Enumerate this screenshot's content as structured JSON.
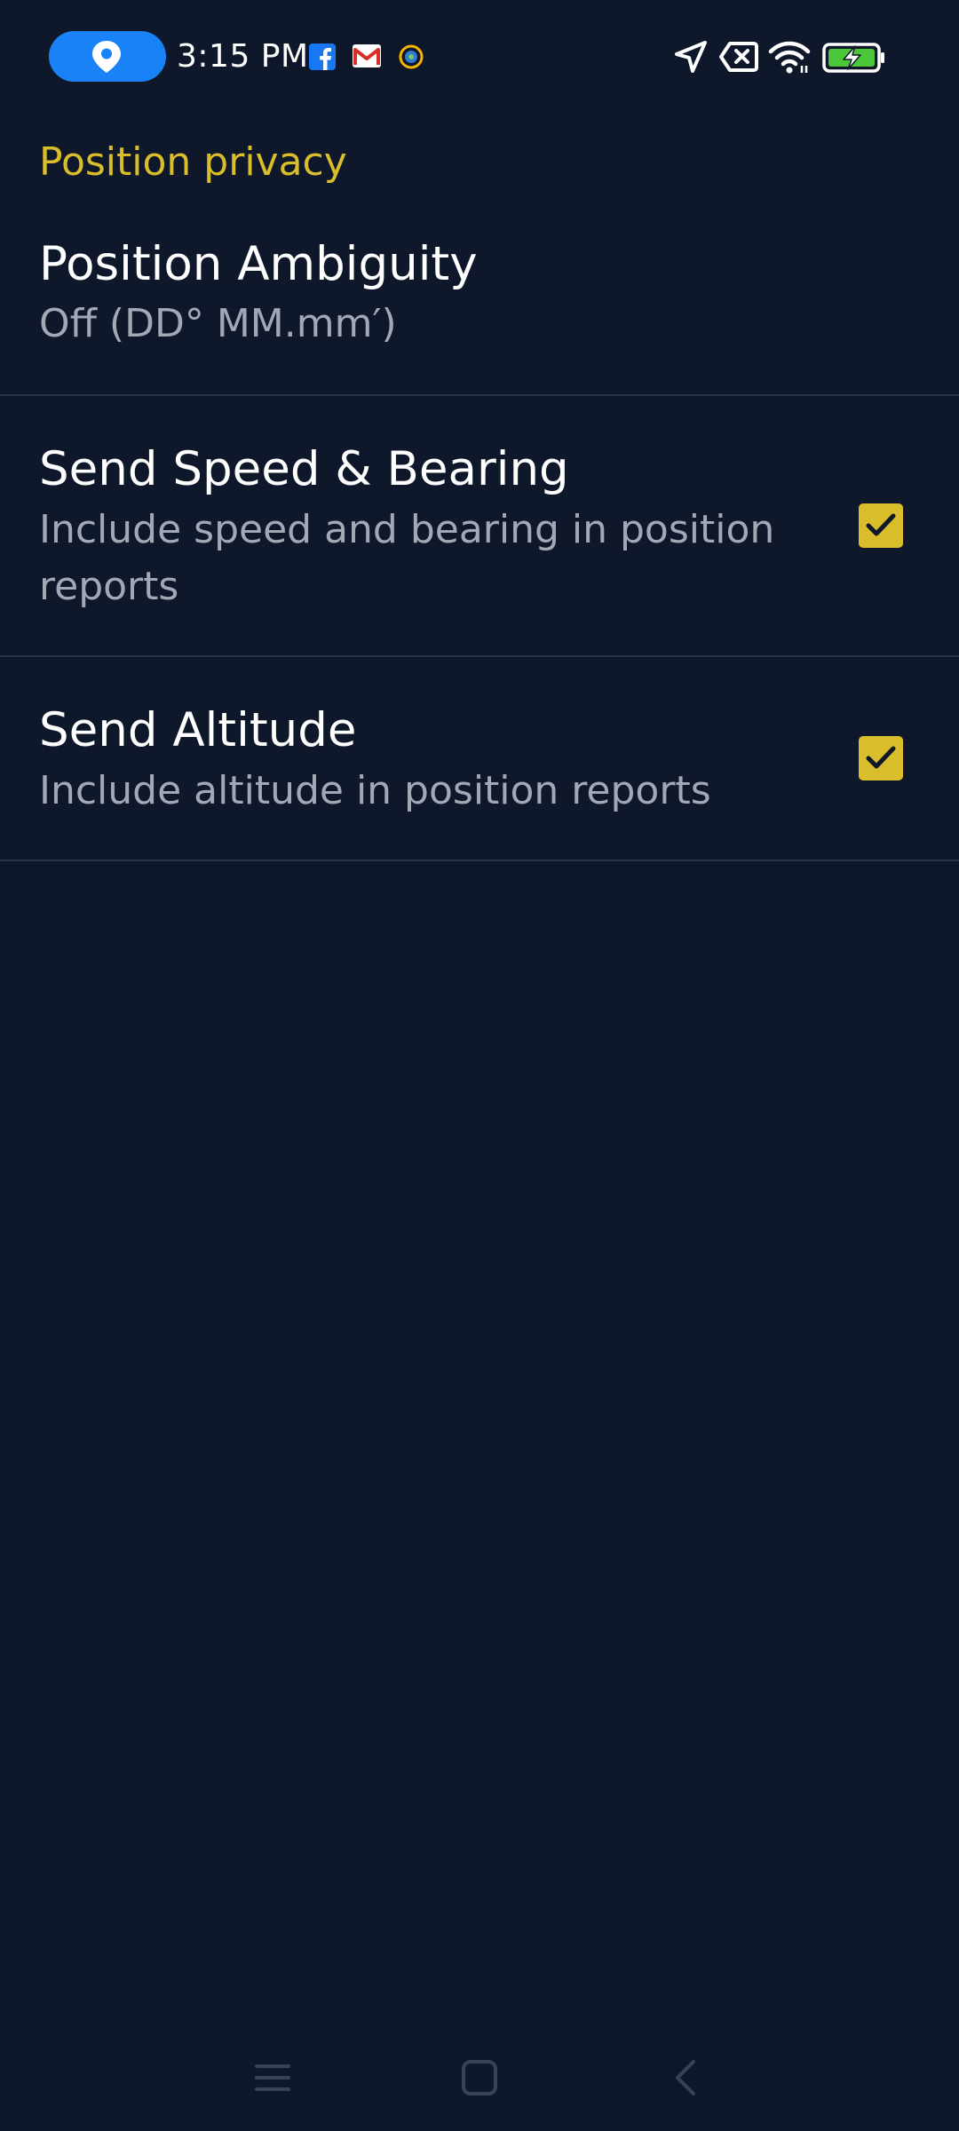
{
  "status_bar": {
    "time": "3:15 PM",
    "pill_color": "#1a82f7",
    "notification_icons": [
      "facebook-icon",
      "gmail-icon",
      "app-notification-icon"
    ],
    "system_icons": [
      "location-arrow-icon",
      "no-sim-icon",
      "wifi-icon",
      "battery-charging-icon"
    ]
  },
  "screen": {
    "section_header": "Position privacy",
    "accent_color": "#d9bd2a",
    "preferences": [
      {
        "title": "Position Ambiguity",
        "summary": "Off (DD° MM.mm′)"
      },
      {
        "title": "Send Speed & Bearing",
        "summary": "Include speed and bearing in position reports",
        "checked": true
      },
      {
        "title": "Send Altitude",
        "summary": "Include altitude in position reports",
        "checked": true
      }
    ]
  },
  "nav_bar": {
    "buttons": [
      "menu-icon",
      "home-icon",
      "back-icon"
    ]
  }
}
